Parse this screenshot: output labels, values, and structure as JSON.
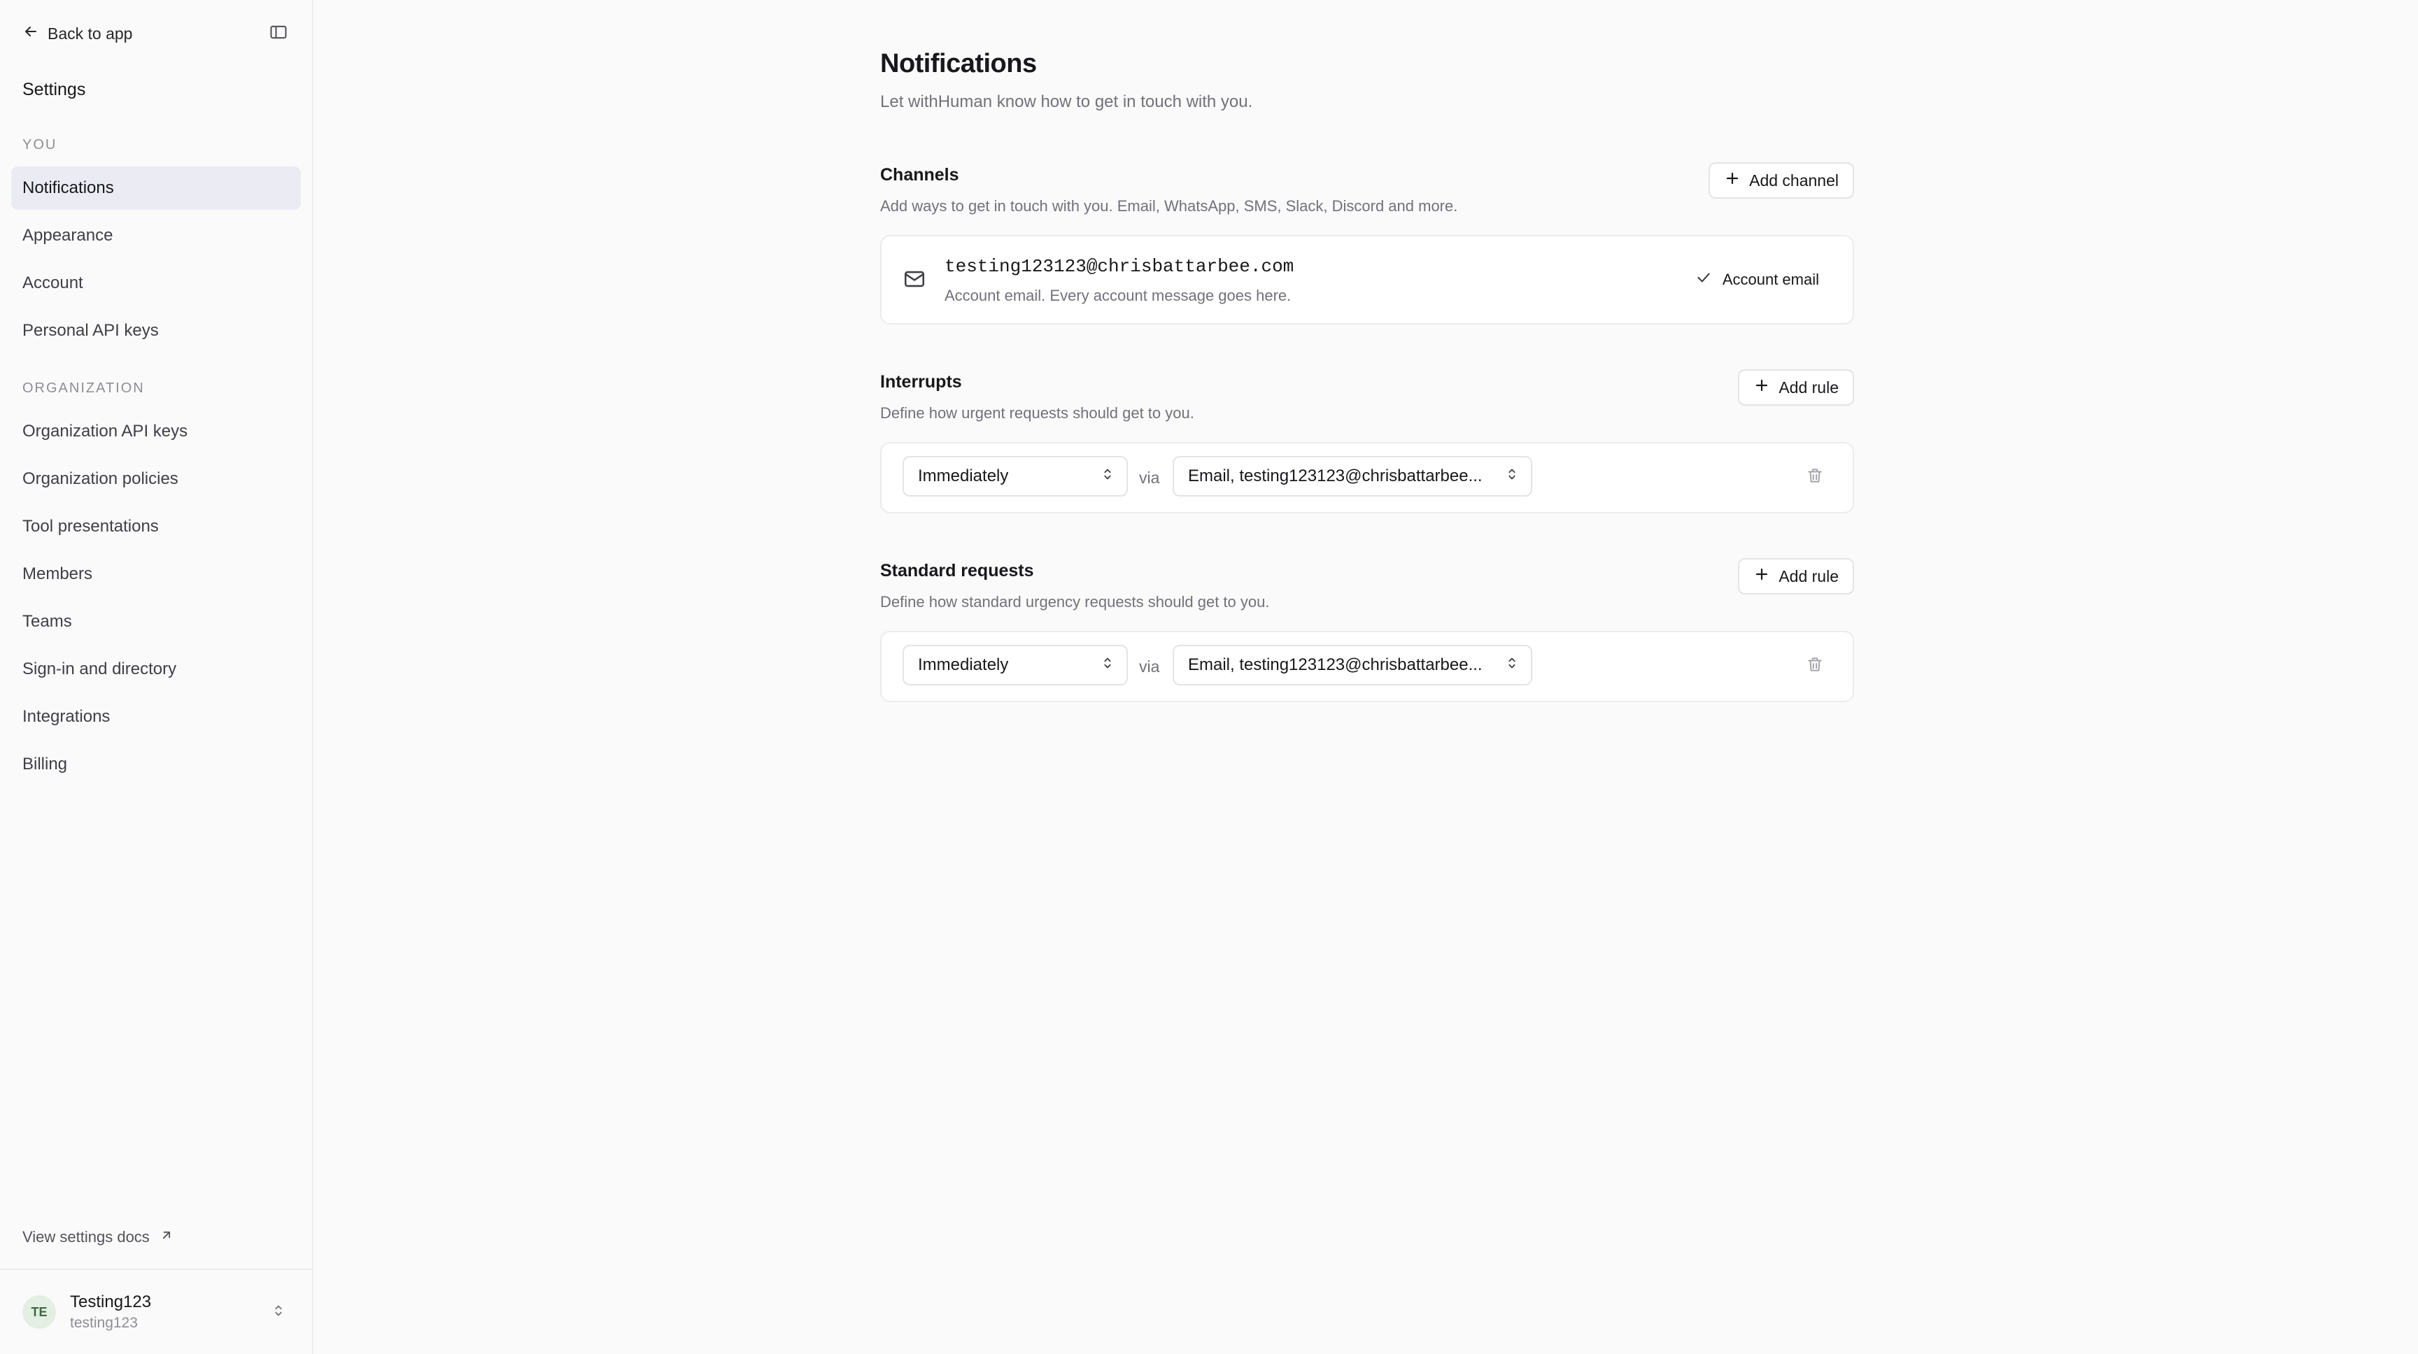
{
  "sidebar": {
    "back_label": "Back to app",
    "settings_title": "Settings",
    "section_you": "YOU",
    "you_items": [
      {
        "label": "Notifications"
      },
      {
        "label": "Appearance"
      },
      {
        "label": "Account"
      },
      {
        "label": "Personal API keys"
      }
    ],
    "section_org": "ORGANIZATION",
    "org_items": [
      {
        "label": "Organization API keys"
      },
      {
        "label": "Organization policies"
      },
      {
        "label": "Tool presentations"
      },
      {
        "label": "Members"
      },
      {
        "label": "Teams"
      },
      {
        "label": "Sign-in and directory"
      },
      {
        "label": "Integrations"
      },
      {
        "label": "Billing"
      }
    ],
    "docs_label": "View settings docs",
    "user": {
      "initials": "TE",
      "name": "Testing123",
      "handle": "testing123"
    }
  },
  "main": {
    "title": "Notifications",
    "subtitle": "Let withHuman know how to get in touch with you.",
    "channels": {
      "title": "Channels",
      "description": "Add ways to get in touch with you. Email, WhatsApp, SMS, Slack, Discord and more.",
      "add_label": "Add channel",
      "items": [
        {
          "email": "testing123123@chrisbattarbee.com",
          "description": "Account email. Every account message goes here.",
          "badge": "Account email"
        }
      ]
    },
    "interrupts": {
      "title": "Interrupts",
      "description": "Define how urgent requests should get to you.",
      "add_label": "Add rule",
      "rule": {
        "timing": "Immediately",
        "via": "via",
        "channel": "Email, testing123123@chrisbattarbee..."
      }
    },
    "standard": {
      "title": "Standard requests",
      "description": "Define how standard urgency requests should get to you.",
      "add_label": "Add rule",
      "rule": {
        "timing": "Immediately",
        "via": "via",
        "channel": "Email, testing123123@chrisbattarbee..."
      }
    }
  },
  "colors": {
    "active_nav": "#ebebf3",
    "border": "#e4e4e7",
    "muted_text": "#71717a"
  }
}
